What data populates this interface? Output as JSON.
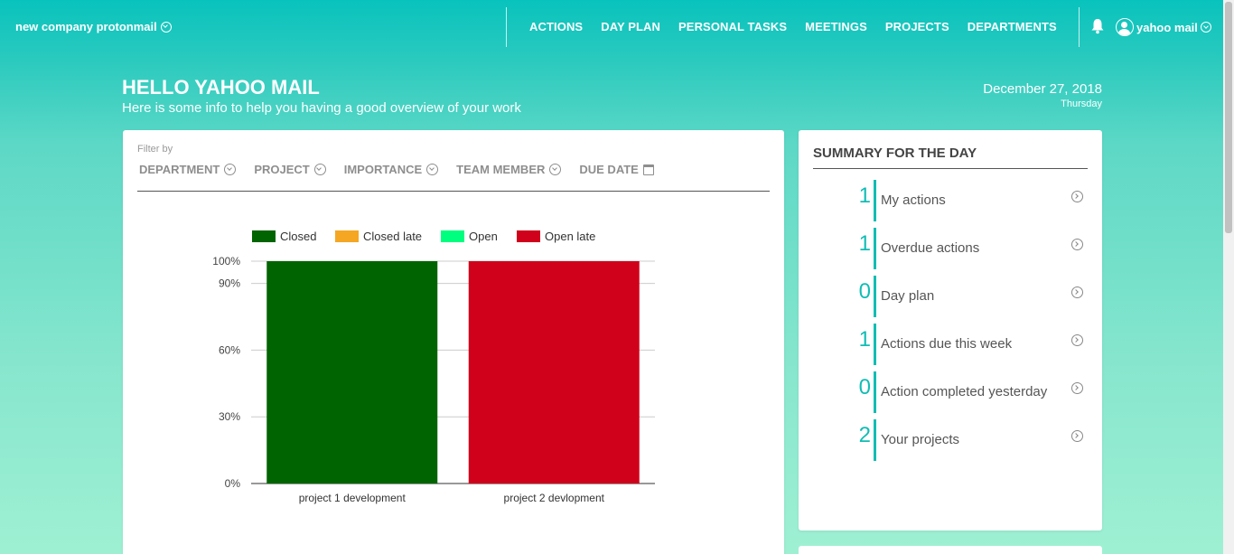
{
  "topbar": {
    "company": "new company protonmail",
    "nav": [
      "ACTIONS",
      "DAY PLAN",
      "PERSONAL TASKS",
      "MEETINGS",
      "PROJECTS",
      "DEPARTMENTS"
    ],
    "user": "yahoo mail"
  },
  "header": {
    "greeting": "HELLO YAHOO MAIL",
    "subtitle": "Here is some info to help you having a good overview of your work",
    "date": "December 27, 2018",
    "day": "Thursday"
  },
  "filters": {
    "label": "Filter by",
    "items": [
      "DEPARTMENT",
      "PROJECT",
      "IMPORTANCE",
      "TEAM MEMBER",
      "DUE DATE"
    ]
  },
  "chart_data": {
    "type": "bar",
    "stacked": true,
    "categories": [
      "project 1 development",
      "project 2 devlopment"
    ],
    "series": [
      {
        "name": "Closed",
        "color": "#006400",
        "values": [
          100,
          0
        ]
      },
      {
        "name": "Closed late",
        "color": "#f5a623",
        "values": [
          0,
          0
        ]
      },
      {
        "name": "Open",
        "color": "#00ff7f",
        "values": [
          0,
          0
        ]
      },
      {
        "name": "Open late",
        "color": "#d0021b",
        "values": [
          0,
          100
        ]
      }
    ],
    "yticks": [
      "0%",
      "30%",
      "60%",
      "90%",
      "100%"
    ],
    "ytick_values": [
      0,
      30,
      60,
      90,
      100
    ],
    "ylim": [
      0,
      100
    ],
    "legend": "top",
    "grid": true
  },
  "summary": {
    "title": "SUMMARY FOR THE DAY",
    "rows": [
      {
        "count": "1",
        "label": "My actions"
      },
      {
        "count": "1",
        "label": "Overdue actions"
      },
      {
        "count": "0",
        "label": "Day plan"
      },
      {
        "count": "1",
        "label": "Actions due this week"
      },
      {
        "count": "0",
        "label": "Action completed yesterday"
      },
      {
        "count": "2",
        "label": "Your projects"
      }
    ]
  }
}
